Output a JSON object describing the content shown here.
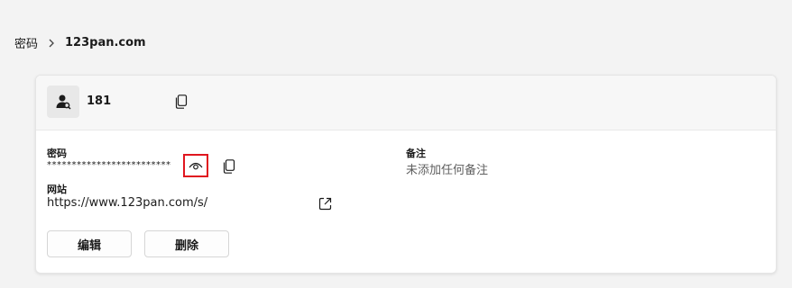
{
  "breadcrumb": {
    "parent": "密码",
    "current": "123pan.com"
  },
  "header": {
    "account": "181"
  },
  "password": {
    "label": "密码",
    "masked_value": "*************************"
  },
  "website": {
    "label": "网站",
    "url": "https://www.123pan.com/s/"
  },
  "note": {
    "label": "备注",
    "value": "未添加任何备注"
  },
  "actions": {
    "edit": "编辑",
    "delete": "删除"
  },
  "icons": {
    "avatar": "user-key-icon",
    "copy": "copy-icon",
    "reveal": "eye-icon",
    "open_link": "open-external-icon",
    "separator": "chevron-right-icon"
  },
  "colors": {
    "highlight_border": "#e0161f",
    "header_bg": "#f7f7f7",
    "page_bg": "#f3f3f3"
  }
}
